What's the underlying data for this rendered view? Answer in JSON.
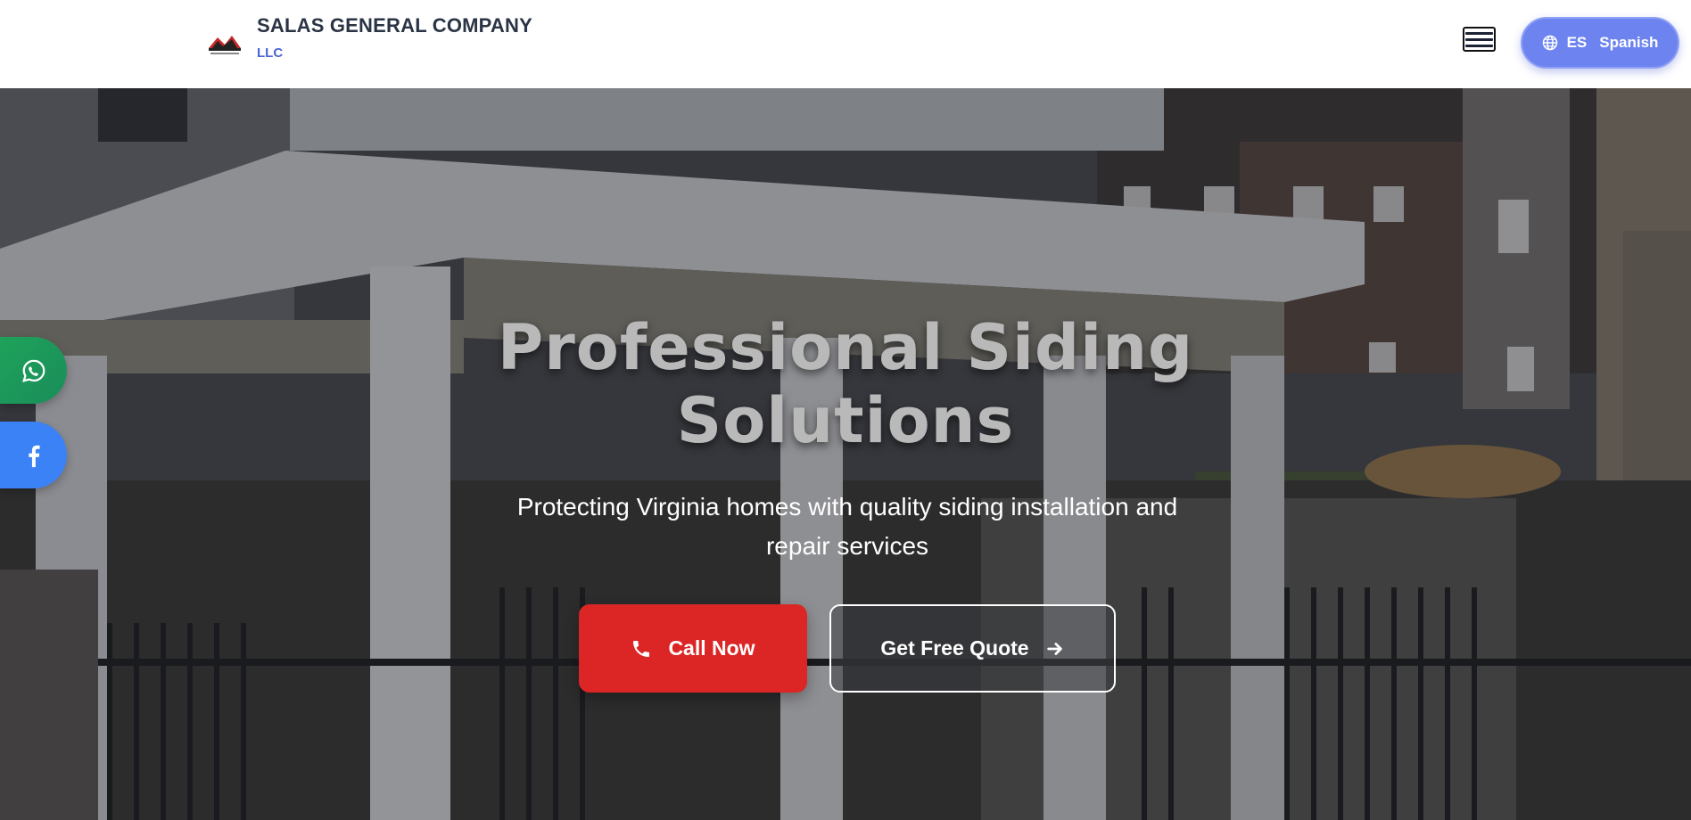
{
  "header": {
    "brand_name": "SALAS GENERAL COMPANY",
    "brand_sub": "LLC",
    "logo_icon": "house-roof-logo-icon",
    "menu_icon": "hamburger-menu-icon",
    "language": {
      "code": "ES",
      "label": "Spanish",
      "icon": "globe-icon"
    }
  },
  "hero": {
    "title": "Professional Siding Solutions",
    "subtitle": "Protecting Virginia homes with quality siding installation and repair services",
    "call_button": {
      "label": "Call Now",
      "icon": "phone-icon"
    },
    "quote_button": {
      "label": "Get Free Quote",
      "icon": "arrow-right-icon"
    }
  },
  "social": [
    {
      "name": "whatsapp",
      "icon": "whatsapp-icon",
      "color": "#1ea25a"
    },
    {
      "name": "facebook",
      "icon": "facebook-icon",
      "color": "#3b82f6"
    }
  ],
  "colors": {
    "accent": "#6d84f0",
    "call_red": "#dc2626",
    "brand_text": "#2b3445",
    "brand_sub": "#4a66d6"
  }
}
